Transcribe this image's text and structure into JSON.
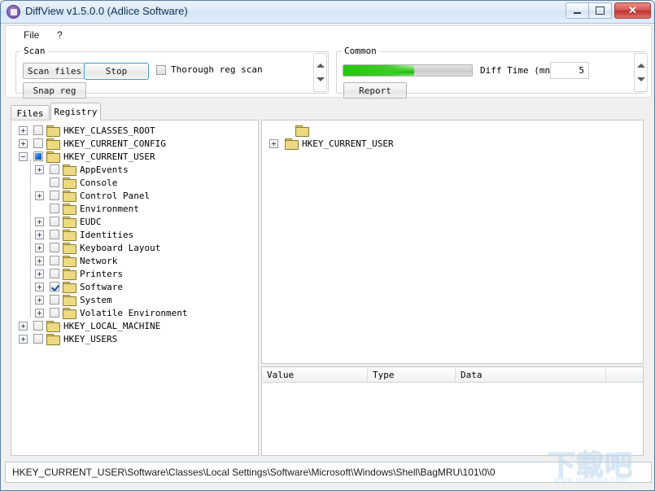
{
  "window": {
    "title": "DiffView v1.5.0.0 (Adlice Software)",
    "icon": "app-icon",
    "buttons": {
      "minimize": "minimize-button",
      "maximize": "maximize-button",
      "close_label": "✕"
    }
  },
  "menubar": {
    "items": [
      {
        "label": "File",
        "name": "menu-file"
      },
      {
        "label": "?",
        "name": "menu-help"
      }
    ]
  },
  "toolbar": {
    "scan_group": {
      "label": "Scan",
      "scan_files_label": "Scan files",
      "snap_reg_label": "Snap reg",
      "stop_label": "Stop",
      "thorough_label": "Thorough reg scan",
      "thorough_checked": false
    },
    "common_group": {
      "label": "Common",
      "report_label": "Report",
      "progress_percent": 55,
      "progress_color": "#12bb06",
      "diff_time_label": "Diff Time (mn)",
      "diff_time_value": "5"
    }
  },
  "tabs": [
    {
      "label": "Files",
      "name": "tab-files",
      "active": false
    },
    {
      "label": "Registry",
      "name": "tab-registry",
      "active": true
    }
  ],
  "tree_left": [
    {
      "label": "HKEY_CLASSES_ROOT",
      "depth": 0,
      "expander": "plus",
      "check": "none"
    },
    {
      "label": "HKEY_CURRENT_CONFIG",
      "depth": 0,
      "expander": "plus",
      "check": "none"
    },
    {
      "label": "HKEY_CURRENT_USER",
      "depth": 0,
      "expander": "minus",
      "check": "partial"
    },
    {
      "label": "AppEvents",
      "depth": 1,
      "expander": "plus",
      "check": "none"
    },
    {
      "label": "Console",
      "depth": 1,
      "expander": "none",
      "check": "none"
    },
    {
      "label": "Control Panel",
      "depth": 1,
      "expander": "plus",
      "check": "none"
    },
    {
      "label": "Environment",
      "depth": 1,
      "expander": "none",
      "check": "none"
    },
    {
      "label": "EUDC",
      "depth": 1,
      "expander": "plus",
      "check": "none"
    },
    {
      "label": "Identities",
      "depth": 1,
      "expander": "plus",
      "check": "none"
    },
    {
      "label": "Keyboard Layout",
      "depth": 1,
      "expander": "plus",
      "check": "none"
    },
    {
      "label": "Network",
      "depth": 1,
      "expander": "plus",
      "check": "none"
    },
    {
      "label": "Printers",
      "depth": 1,
      "expander": "plus",
      "check": "none"
    },
    {
      "label": "Software",
      "depth": 1,
      "expander": "plus",
      "check": "checked"
    },
    {
      "label": "System",
      "depth": 1,
      "expander": "plus",
      "check": "none"
    },
    {
      "label": "Volatile Environment",
      "depth": 1,
      "expander": "plus",
      "check": "none"
    },
    {
      "label": "HKEY_LOCAL_MACHINE",
      "depth": 0,
      "expander": "plus",
      "check": "none"
    },
    {
      "label": "HKEY_USERS",
      "depth": 0,
      "expander": "plus",
      "check": "none"
    }
  ],
  "tree_right": [
    {
      "label": "",
      "depth": 1,
      "expander": "none"
    },
    {
      "label": "HKEY_CURRENT_USER",
      "depth": 0,
      "expander": "plus"
    }
  ],
  "list": {
    "columns": [
      "Value",
      "Type",
      "Data",
      ""
    ],
    "rows": []
  },
  "statusbar": {
    "path": "HKEY_CURRENT_USER\\Software\\Classes\\Local Settings\\Software\\Microsoft\\Windows\\Shell\\BagMRU\\101\\0\\0"
  },
  "watermark": {
    "text": "下载吧",
    "url": "www.xiazaiba.com"
  }
}
